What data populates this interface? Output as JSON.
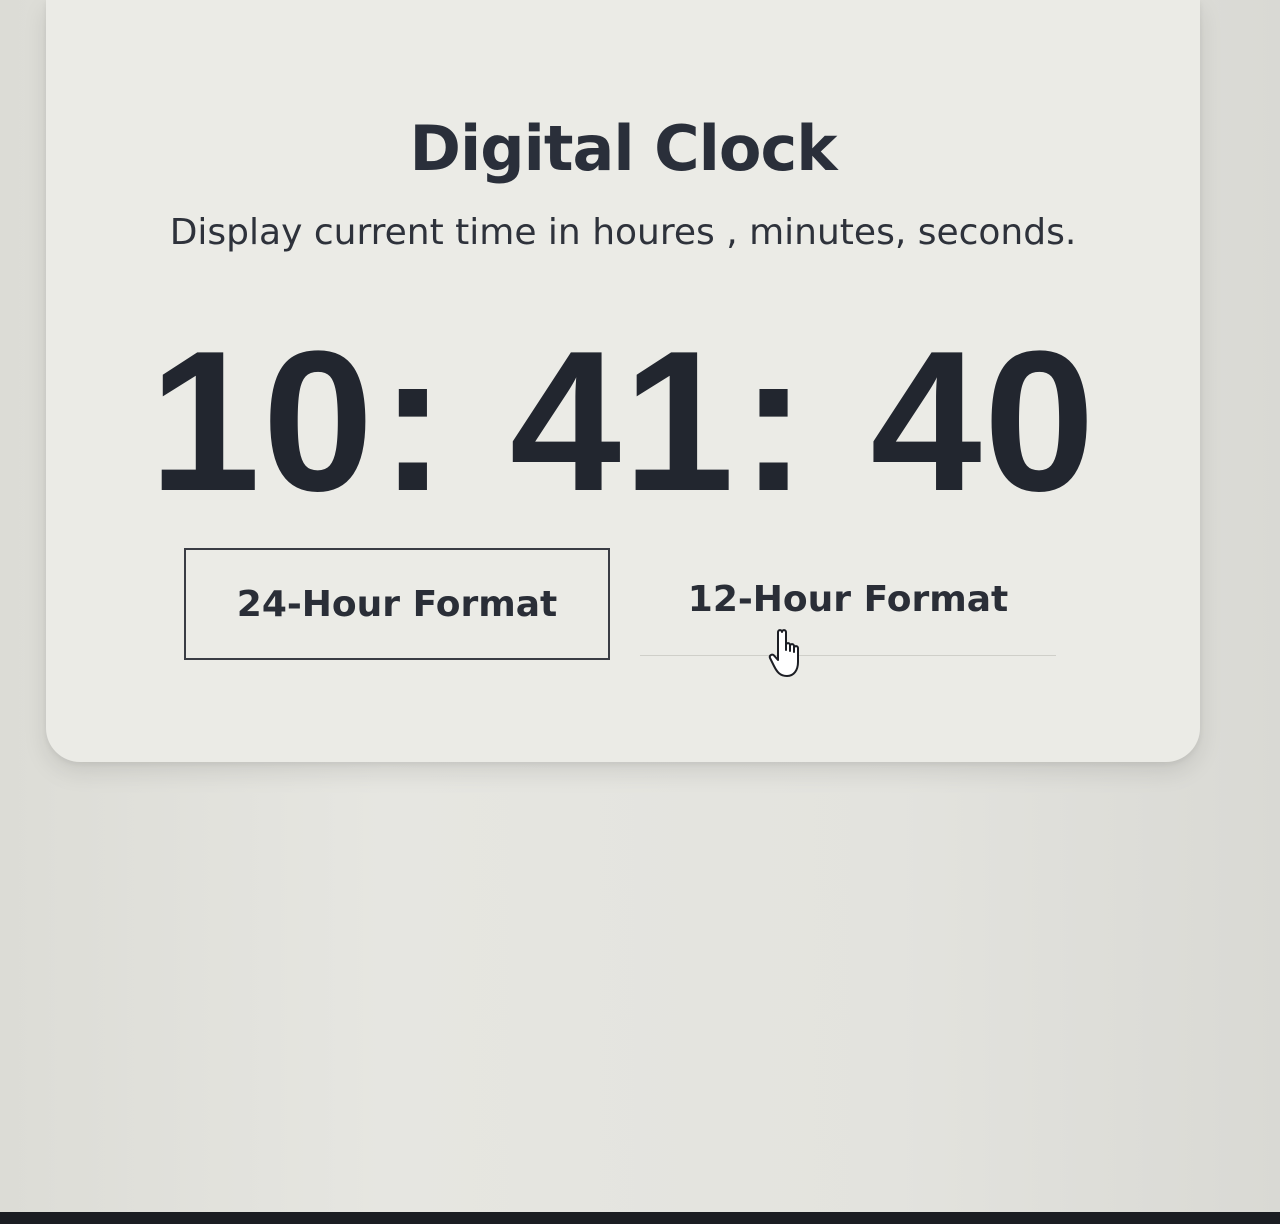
{
  "card": {
    "title": "Digital Clock",
    "subtitle": "Display current time in houres , minutes, seconds."
  },
  "clock": {
    "hours": "10",
    "minutes": "41",
    "seconds": "40",
    "separator": ":"
  },
  "buttons": {
    "format_24_label": "24-Hour Format",
    "format_12_label": "12-Hour Format"
  },
  "cursor": {
    "icon": "hand-pointer-icon"
  },
  "colors": {
    "text_dark": "#22262f",
    "card_bg": "#ebebe6",
    "page_bg": "#e3e3de"
  }
}
